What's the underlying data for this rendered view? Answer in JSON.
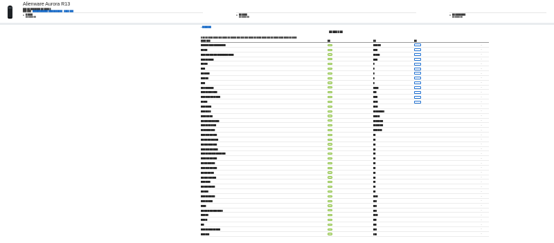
{
  "header": {
    "title": "Alienware Aurora R13",
    "sub1": "███ ██ ████████ ██ ████ █",
    "sub2_prefix": "███ ███ ·",
    "sub2_link": "████████████ ███████████ · ████ ███",
    "cards": [
      {
        "label": "█ ████",
        "sub": "██ ████ ██"
      },
      {
        "label": "██ ████",
        "sub": "██ ████ ██"
      },
      {
        "label": "██ ████████",
        "sub": "██ ████ ██"
      }
    ]
  },
  "main": {
    "back_link": "◂ ███████",
    "table_title": "██ ███ █ ██",
    "intro": "█ ██ ██ ████ ████ ███ ████ ██ █████ ███ ███ ███ ████ ██ ████ ████ ███ ██ ████ ████ ████ ██ ████",
    "columns": [
      "████ ███",
      "██",
      "██",
      "██"
    ],
    "rows": [
      {
        "name": "████████ ████ ████████████",
        "value": "████ ███",
        "button": true
      },
      {
        "name": "███ ███",
        "value": "████",
        "button": true
      },
      {
        "name": "████ █ ███ ████ ███ ███████████ █████",
        "value": "██ ████",
        "button": true
      },
      {
        "name": "████ ███ █████",
        "value": "████",
        "button": true
      },
      {
        "name": "███ ██ █",
        "value": "█",
        "button": true
      },
      {
        "name": "████",
        "value": "█",
        "button": true
      },
      {
        "name": "███ ██ ███",
        "value": "█",
        "button": true
      },
      {
        "name": "████ ███",
        "value": "█",
        "button": true
      },
      {
        "name": "████",
        "value": "█",
        "button": true
      },
      {
        "name": "███ █ ████████",
        "value": "█████",
        "button": true
      },
      {
        "name": "████ ███ ███ █ ████",
        "value": "███",
        "button": true
      },
      {
        "name": "████ █████ ███ ██ ████",
        "value": "████",
        "button": true
      },
      {
        "name": "██ ████",
        "value": "██ ██",
        "button": true
      },
      {
        "name": "████ ██████",
        "value": "██ ██",
        "button": false
      },
      {
        "name": "████ ███ █ █",
        "value": "██ ███ ████ █",
        "button": false
      },
      {
        "name": "█████ ███ ███",
        "value": "████ ██",
        "button": false
      },
      {
        "name": "███ ████ ███ ███ ████",
        "value": "██ ████ ███",
        "button": false
      },
      {
        "name": "████ ███ ██ ██ ███",
        "value": "██ ████ ███",
        "button": false
      },
      {
        "name": "██ ███ ████ ████",
        "value": "████ ██ ██",
        "button": false
      },
      {
        "name": "████ ████ ███ ████",
        "value": "██",
        "button": false
      },
      {
        "name": "███ ███ ███ ████ ███",
        "value": "██",
        "button": false
      },
      {
        "name": "███ ████ ████ ████",
        "value": "██",
        "button": false
      },
      {
        "name": "████ ████ ███ █████",
        "value": "██",
        "button": false
      },
      {
        "name": "████ ███ ███ ████ ██████ ███",
        "value": "██",
        "button": false
      },
      {
        "name": "█████ ███ ███ ████",
        "value": "██",
        "button": false
      },
      {
        "name": "███ ███ ████ ███",
        "value": "██",
        "button": false
      },
      {
        "name": "████ ████ ███ ████",
        "value": "██",
        "button": false
      },
      {
        "name": "███ ███ ███ ███",
        "value": "██",
        "button": false
      },
      {
        "name": "███ ███ █ ███ ████",
        "value": "██",
        "button": false
      },
      {
        "name": "████ █████",
        "value": "██",
        "button": false
      },
      {
        "name": "███ ████ ███ ███",
        "value": "██",
        "button": false
      },
      {
        "name": "███ ████",
        "value": "██",
        "button": false
      },
      {
        "name": "████ ███ ███ ███",
        "value": "██ ██",
        "button": false
      },
      {
        "name": "████ ███ ████",
        "value": "██ █",
        "button": false
      },
      {
        "name": "█████",
        "value": "██ █",
        "button": false
      },
      {
        "name": "███ ███ ██ ███ ████ ████ █",
        "value": "██ █",
        "button": false
      },
      {
        "name": "████ ███",
        "value": "██ ██",
        "button": false
      },
      {
        "name": "████ ██",
        "value": "███",
        "button": false
      },
      {
        "name": "███",
        "value": "███",
        "button": false
      },
      {
        "name": "████ ███ ████ ███ ████",
        "value": "██ █",
        "button": false
      },
      {
        "name": "████ ████",
        "value": "█ ██",
        "button": false
      }
    ]
  }
}
